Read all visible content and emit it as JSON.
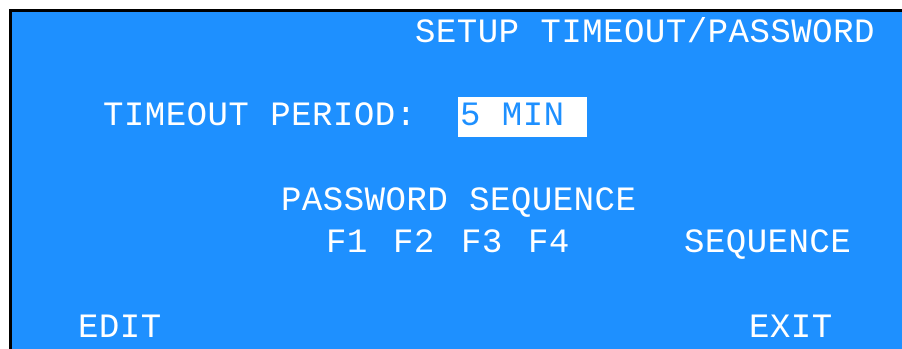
{
  "screen": {
    "title": "SETUP TIMEOUT/PASSWORD",
    "background_color": "#1e90ff",
    "text_color": "#ffffff"
  },
  "timeout": {
    "label": "TIMEOUT PERIOD:",
    "value": "5 MIN"
  },
  "password": {
    "heading": "PASSWORD SEQUENCE",
    "keys": [
      "F1",
      "F2",
      "F3",
      "F4"
    ],
    "sequence_label": "SEQUENCE"
  },
  "softkeys": {
    "edit_label": "EDIT",
    "exit_label": "EXIT"
  }
}
